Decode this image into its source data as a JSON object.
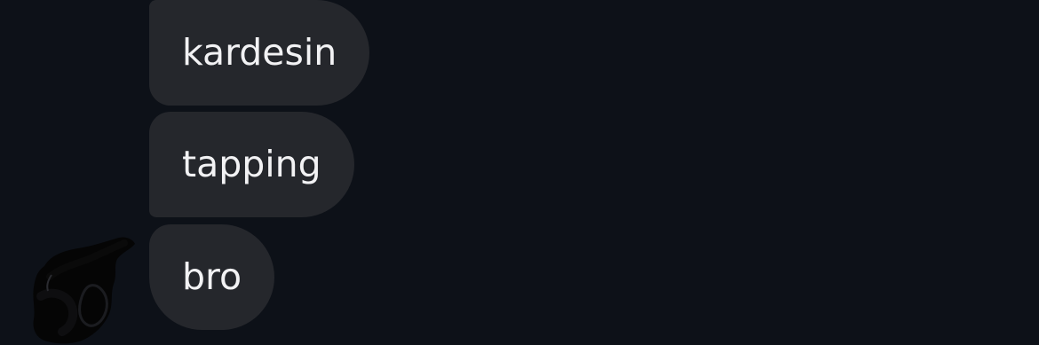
{
  "messages": [
    {
      "text": "kardesin"
    },
    {
      "text": "tapping"
    },
    {
      "text": "bro"
    }
  ],
  "avatar": {
    "icon": "scribbled-avatar-icon"
  },
  "colors": {
    "background": "#0d1118",
    "bubble": "#25272c",
    "text": "#f2f2f4"
  }
}
